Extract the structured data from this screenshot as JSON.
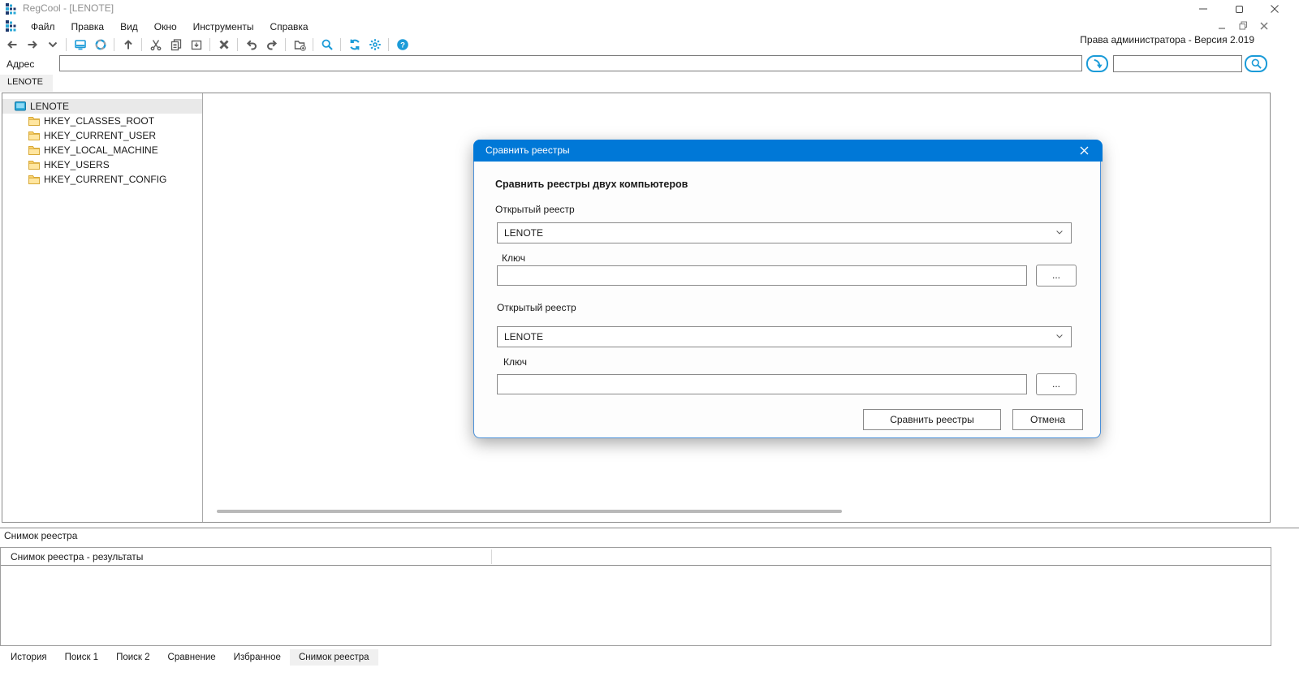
{
  "window": {
    "title": "RegCool - [LENOTE]",
    "status_right": "Права администратора - Версия 2.019"
  },
  "menu": {
    "items": [
      "Файл",
      "Правка",
      "Вид",
      "Окно",
      "Инструменты",
      "Справка"
    ]
  },
  "toolbar": {
    "items": [
      "back-icon",
      "forward-icon",
      "chevron-down-icon",
      "|",
      "computer-icon",
      "reload-icon",
      "|",
      "up-icon",
      "|",
      "cut-icon",
      "copy-icon",
      "paste-icon",
      "|",
      "delete-icon",
      "|",
      "undo-icon",
      "redo-icon",
      "|",
      "new-key-icon",
      "|",
      "search-icon",
      "|",
      "refresh-icon",
      "settings-icon",
      "|",
      "help-icon"
    ]
  },
  "address": {
    "label": "Адрес",
    "value": "",
    "go_icon": "go-arrow-icon",
    "search_value": "",
    "search_icon": "search-icon"
  },
  "top_tabs": {
    "items": [
      "LENOTE"
    ],
    "active": "LENOTE"
  },
  "tree": {
    "root": {
      "label": "LENOTE",
      "icon": "computer-node-icon",
      "selected": true
    },
    "children": [
      {
        "label": "HKEY_CLASSES_ROOT",
        "icon": "folder-icon"
      },
      {
        "label": "HKEY_CURRENT_USER",
        "icon": "folder-icon"
      },
      {
        "label": "HKEY_LOCAL_MACHINE",
        "icon": "folder-icon"
      },
      {
        "label": "HKEY_USERS",
        "icon": "folder-icon"
      },
      {
        "label": "HKEY_CURRENT_CONFIG",
        "icon": "folder-icon"
      }
    ]
  },
  "dialog": {
    "title": "Сравнить реестры",
    "close_icon": "close-icon",
    "heading": "Сравнить реестры двух компьютеров",
    "sections": [
      {
        "registry_label": "Открытый реестр",
        "registry_value": "LENOTE",
        "key_label": "Ключ",
        "key_value": "",
        "browse_label": "..."
      },
      {
        "registry_label": "Открытый реестр",
        "registry_value": "LENOTE",
        "key_label": "Ключ",
        "key_value": "",
        "browse_label": "..."
      }
    ],
    "compare_button": "Сравнить реестры",
    "cancel_button": "Отмена"
  },
  "bottom_panel": {
    "caption": "Снимок реестра",
    "results_header": "Снимок реестра - результаты"
  },
  "bottom_tabs": {
    "items": [
      "История",
      "Поиск 1",
      "Поиск 2",
      "Сравнение",
      "Избранное",
      "Снимок реестра"
    ],
    "active": "Снимок реестра"
  },
  "colors": {
    "accent_blue": "#1b9bd8",
    "dialog_title_bg": "#0078d7",
    "icon_gray": "#5a5a5a"
  }
}
